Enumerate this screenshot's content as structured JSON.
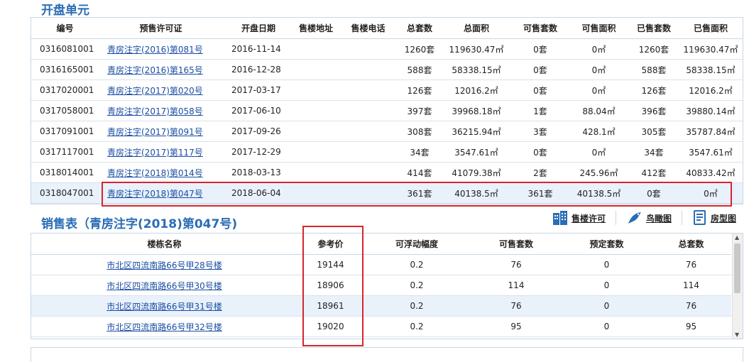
{
  "units_section": {
    "title": "开盘单元",
    "headers": [
      "编号",
      "预售许可证",
      "开盘日期",
      "售楼地址",
      "售楼电话",
      "总套数",
      "总面积",
      "可售套数",
      "可售面积",
      "已售套数",
      "已售面积"
    ],
    "rows": [
      [
        "0316081001",
        "青房注字(2016)第081号",
        "2016-11-14",
        "",
        "",
        "1260套",
        "119630.47㎡",
        "0套",
        "0㎡",
        "1260套",
        "119630.47㎡"
      ],
      [
        "0316165001",
        "青房注字(2016)第165号",
        "2016-12-28",
        "",
        "",
        "588套",
        "58338.15㎡",
        "0套",
        "0㎡",
        "588套",
        "58338.15㎡"
      ],
      [
        "0317020001",
        "青房注字(2017)第020号",
        "2017-03-17",
        "",
        "",
        "126套",
        "12016.2㎡",
        "0套",
        "0㎡",
        "126套",
        "12016.2㎡"
      ],
      [
        "0317058001",
        "青房注字(2017)第058号",
        "2017-06-10",
        "",
        "",
        "397套",
        "39968.18㎡",
        "1套",
        "88.04㎡",
        "396套",
        "39880.14㎡"
      ],
      [
        "0317091001",
        "青房注字(2017)第091号",
        "2017-09-26",
        "",
        "",
        "308套",
        "36215.94㎡",
        "3套",
        "428.1㎡",
        "305套",
        "35787.84㎡"
      ],
      [
        "0317117001",
        "青房注字(2017)第117号",
        "2017-12-29",
        "",
        "",
        "34套",
        "3547.61㎡",
        "0套",
        "0㎡",
        "34套",
        "3547.61㎡"
      ],
      [
        "0318014001",
        "青房注字(2018)第014号",
        "2018-03-13",
        "",
        "",
        "414套",
        "41079.38㎡",
        "2套",
        "245.96㎡",
        "412套",
        "40833.42㎡"
      ],
      [
        "0318047001",
        "青房注字(2018)第047号",
        "2018-06-04",
        "",
        "",
        "361套",
        "40138.5㎡",
        "361套",
        "40138.5㎡",
        "0套",
        "0㎡"
      ]
    ]
  },
  "sales_section": {
    "title": "销售表（青房注字(2018)第047号)",
    "tools": [
      "售楼许可",
      "鸟瞰图",
      "房型图"
    ],
    "headers": [
      "楼栋名称",
      "参考价",
      "可浮动幅度",
      "可售套数",
      "预定套数",
      "总套数"
    ],
    "rows": [
      [
        "市北区四流南路66号甲28号楼",
        "19144",
        "0.2",
        "76",
        "0",
        "76"
      ],
      [
        "市北区四流南路66号甲30号楼",
        "18906",
        "0.2",
        "114",
        "0",
        "114"
      ],
      [
        "市北区四流南路66号甲31号楼",
        "18961",
        "0.2",
        "76",
        "0",
        "76"
      ],
      [
        "市北区四流南路66号甲32号楼",
        "19020",
        "0.2",
        "95",
        "0",
        "95"
      ]
    ]
  },
  "colors": {
    "accent": "#2a6db5",
    "link": "#1a4ea3",
    "highlight_row": "#e9f1fb",
    "annotation": "#d6262b"
  }
}
